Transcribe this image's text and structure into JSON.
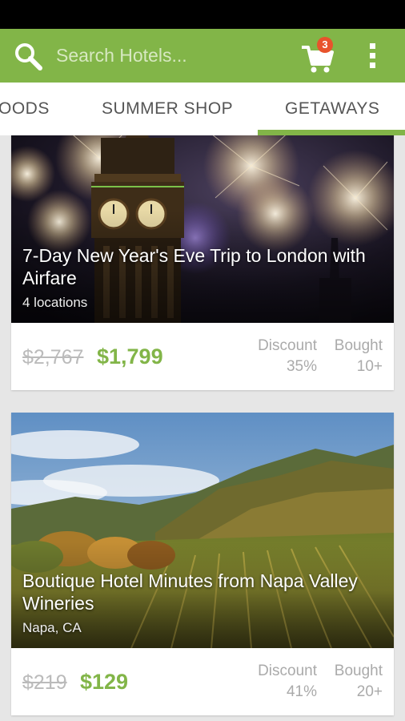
{
  "search": {
    "placeholder": "Search Hotels..."
  },
  "cart": {
    "count": "3"
  },
  "tabs": [
    {
      "label": "OODS"
    },
    {
      "label": "SUMMER SHOP"
    },
    {
      "label": "GETAWAYS",
      "active": true
    }
  ],
  "colors": {
    "brand_green": "#82b548",
    "badge": "#e8532c",
    "status_bar": "#000000"
  },
  "deals": [
    {
      "title": "7-Day New Year's Eve Trip to London with Airfare",
      "subtitle": "4 locations",
      "original_price": "$2,767",
      "price": "$1,799",
      "discount_label": "Discount",
      "discount_value": "35%",
      "bought_label": "Bought",
      "bought_value": "10+"
    },
    {
      "title": "Boutique Hotel Minutes from Napa Valley Wineries",
      "subtitle": "Napa, CA",
      "original_price": "$219",
      "price": "$129",
      "discount_label": "Discount",
      "discount_value": "41%",
      "bought_label": "Bought",
      "bought_value": "20+"
    }
  ],
  "icons": {
    "search": "search-icon",
    "cart": "cart-icon",
    "menu": "overflow-menu-icon"
  }
}
